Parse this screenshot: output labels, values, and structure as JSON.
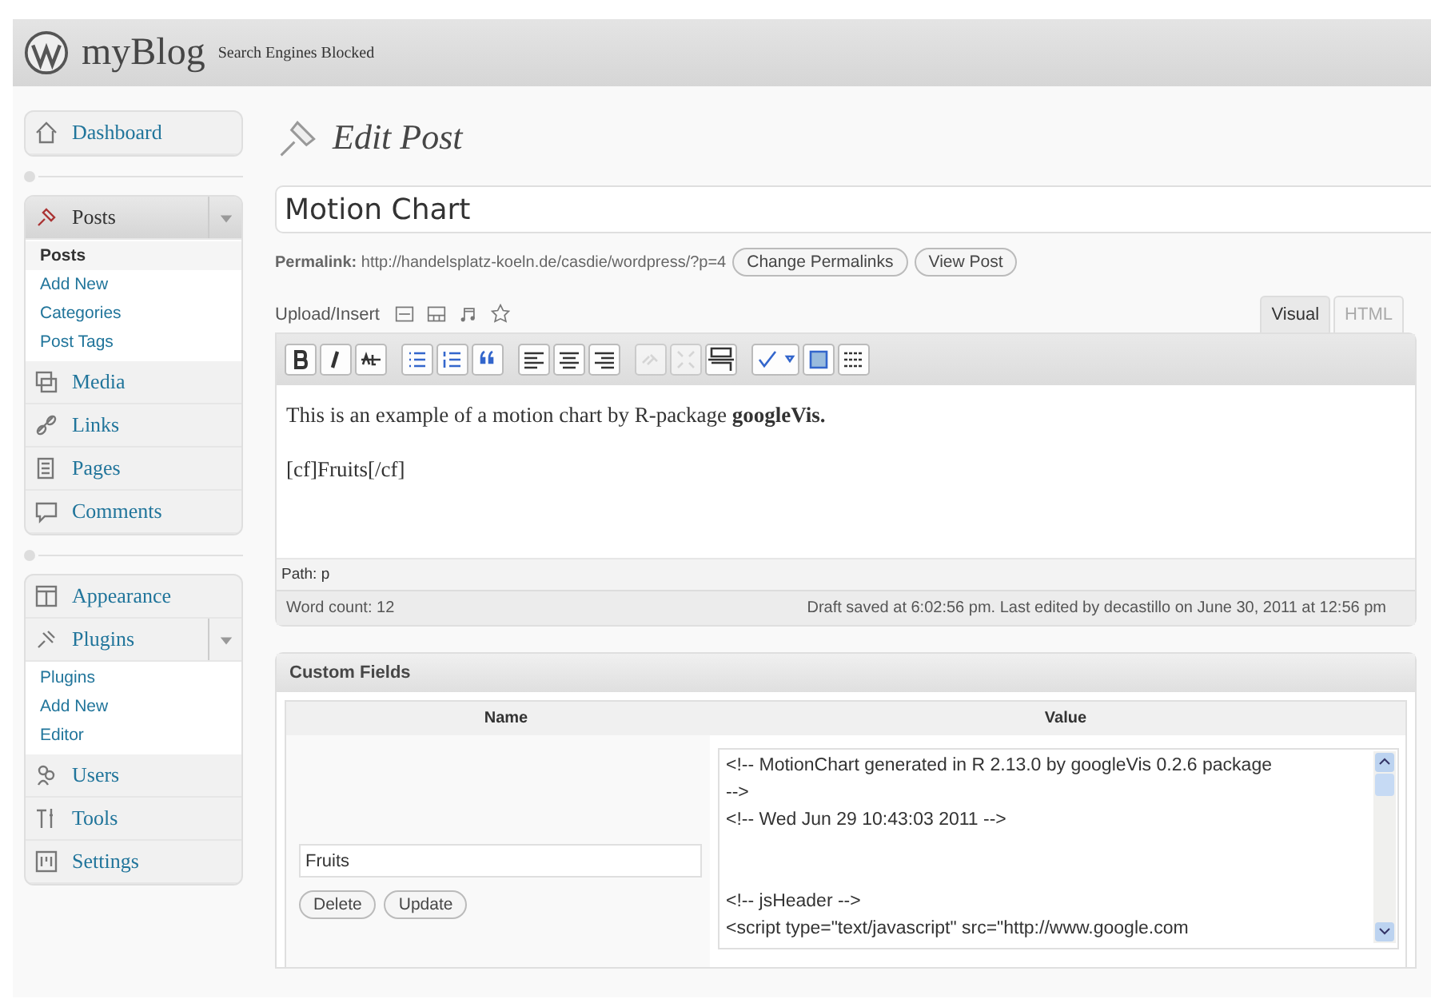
{
  "header": {
    "site_title": "myBlog",
    "notice": "Search Engines Blocked"
  },
  "sidebar": {
    "groups": [
      {
        "items": [
          {
            "label": "Dashboard",
            "selected": false
          }
        ]
      },
      {
        "items": [
          {
            "label": "Posts",
            "selected": true,
            "expanded": true,
            "children": [
              {
                "label": "Posts",
                "selected": true
              },
              {
                "label": "Add New",
                "selected": false
              },
              {
                "label": "Categories",
                "selected": false
              },
              {
                "label": "Post Tags",
                "selected": false
              }
            ]
          },
          {
            "label": "Media",
            "selected": false
          },
          {
            "label": "Links",
            "selected": false
          },
          {
            "label": "Pages",
            "selected": false
          },
          {
            "label": "Comments",
            "selected": false
          }
        ]
      },
      {
        "items": [
          {
            "label": "Appearance",
            "selected": false
          },
          {
            "label": "Plugins",
            "selected": false,
            "expanded": true,
            "children": [
              {
                "label": "Plugins",
                "selected": false
              },
              {
                "label": "Add New",
                "selected": false
              },
              {
                "label": "Editor",
                "selected": false
              }
            ]
          },
          {
            "label": "Users",
            "selected": false
          },
          {
            "label": "Tools",
            "selected": false
          },
          {
            "label": "Settings",
            "selected": false
          }
        ]
      }
    ]
  },
  "page_title": "Edit Post",
  "post_title": "Motion Chart",
  "permalink": {
    "label": "Permalink:",
    "url": "http://handelsplatz-koeln.de/casdie/wordpress/?p=4",
    "buttons": [
      "Change Permalinks",
      "View Post"
    ]
  },
  "upload_insert": "Upload/Insert",
  "editor_tabs": [
    {
      "label": "Visual",
      "selected": true
    },
    {
      "label": "HTML",
      "selected": false
    }
  ],
  "toolbar": [
    {
      "kind": "bold",
      "disabled": false
    },
    {
      "kind": "italic",
      "disabled": false
    },
    {
      "kind": "strike",
      "disabled": false
    },
    {
      "kind": "sep"
    },
    {
      "kind": "bullets",
      "disabled": false
    },
    {
      "kind": "numbers",
      "disabled": false
    },
    {
      "kind": "quote",
      "disabled": false
    },
    {
      "kind": "sep"
    },
    {
      "kind": "align-left",
      "disabled": false
    },
    {
      "kind": "align-center",
      "disabled": false
    },
    {
      "kind": "align-right",
      "disabled": false
    },
    {
      "kind": "sep"
    },
    {
      "kind": "link",
      "disabled": true
    },
    {
      "kind": "unlink",
      "disabled": true
    },
    {
      "kind": "more",
      "disabled": false
    },
    {
      "kind": "sep"
    },
    {
      "kind": "spell",
      "disabled": false
    },
    {
      "kind": "fullscreen",
      "disabled": false
    },
    {
      "kind": "kitchen",
      "disabled": false
    }
  ],
  "content": [
    "This is an example of a motion chart by R-package **googleVis.**",
    "[cf]Fruits[/cf]"
  ],
  "path": "Path: p",
  "word_count": "Word count: 12",
  "draft_status": "Draft saved at 6:02:56 pm. Last edited by decastillo on June 30, 2011 at 12:56 pm",
  "custom_fields": {
    "title": "Custom Fields",
    "columns": [
      "Name",
      "Value"
    ],
    "name_value": "Fruits",
    "buttons": [
      "Delete",
      "Update"
    ],
    "value_blocks": [
      [
        "<!-- MotionChart generated in R 2.13.0 by googleVis 0.2.6 package -->",
        "<!-- Wed Jun 29 10:43:03 2011 -->"
      ],
      [
        "<!-- jsHeader -->",
        "<script type=\"text/javascript\" src=\"http://www.google.com"
      ]
    ]
  }
}
